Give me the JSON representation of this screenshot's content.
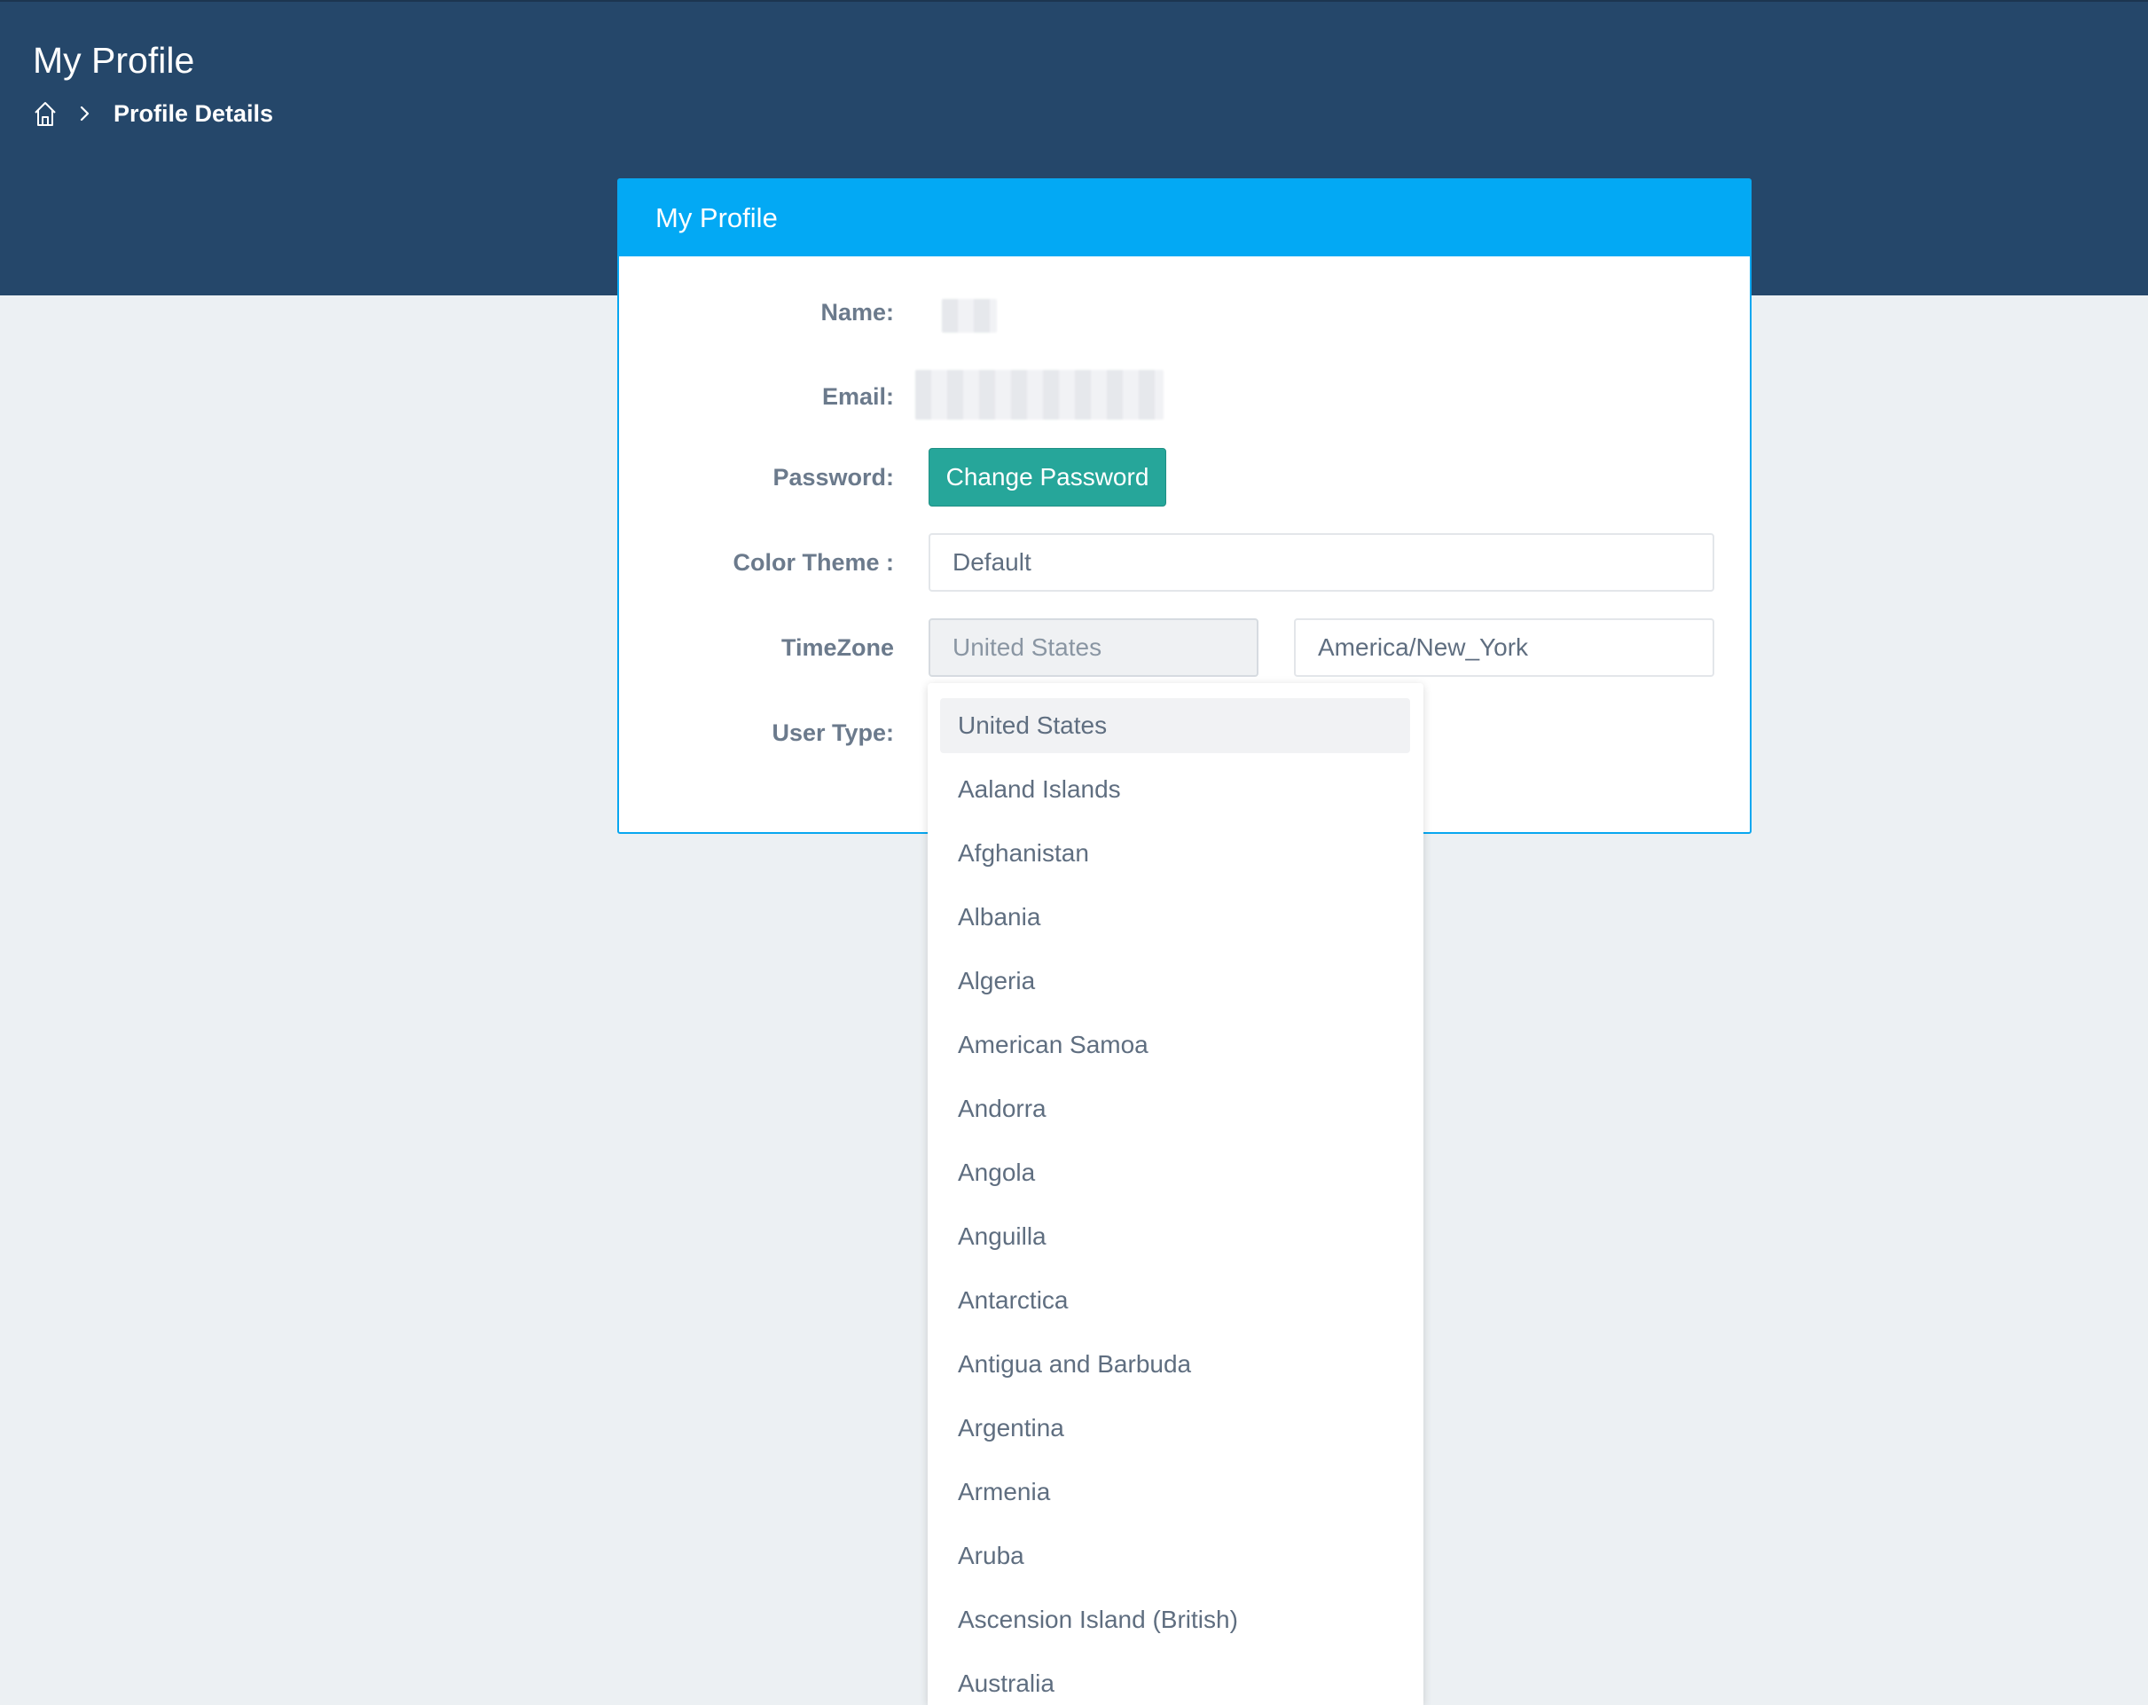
{
  "header": {
    "title": "My Profile",
    "breadcrumb": {
      "home_icon": "home-icon",
      "separator_icon": "chevron-right-icon",
      "current": "Profile Details"
    }
  },
  "colors": {
    "header_bg": "#25476a",
    "card_accent": "#03a9f4",
    "button_bg": "#26a69a",
    "page_bg": "#ecf0f3"
  },
  "card": {
    "title": "My Profile",
    "labels": {
      "name": "Name:",
      "email": "Email:",
      "password": "Password:",
      "color_theme": "Color Theme :",
      "timezone": "TimeZone",
      "user_type": "User Type:"
    },
    "password_button": "Change Password",
    "color_theme_value": "Default",
    "timezone_country": "United States",
    "timezone_zone": "America/New_York"
  },
  "dropdown": {
    "selected": "United States",
    "options": [
      "United States",
      "Aaland Islands",
      "Afghanistan",
      "Albania",
      "Algeria",
      "American Samoa",
      "Andorra",
      "Angola",
      "Anguilla",
      "Antarctica",
      "Antigua and Barbuda",
      "Argentina",
      "Armenia",
      "Aruba",
      "Ascension Island (British)",
      "Australia"
    ]
  }
}
